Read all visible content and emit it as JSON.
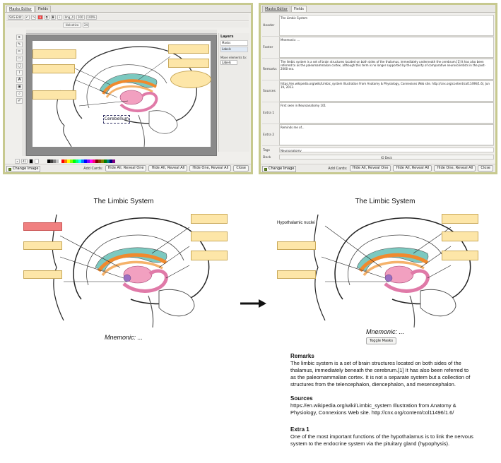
{
  "editor": {
    "tabs": [
      "Masks Editor",
      "Fields"
    ],
    "toolbar": [
      "SVG-Edit",
      "Helvetica",
      "24",
      "Img_4",
      "100",
      "100%"
    ],
    "tools": [
      "arrow-icon",
      "node-icon",
      "pencil-icon",
      "rect-icon",
      "ellipse-icon",
      "path-icon",
      "text-icon",
      "image-icon",
      "zoom-icon",
      "eyedropper-icon"
    ],
    "layers_title": "Layers",
    "layers": [
      "Masks",
      "Labels"
    ],
    "move_label": "Move elements to:",
    "move_value": "Labels",
    "zoom": "41",
    "canvas_label": "Cerebellum",
    "palette": [
      "#000000",
      "#3f3f3f",
      "#7f7f7f",
      "#bfbfbf",
      "#ffffff",
      "#ff0000",
      "#ff7f00",
      "#ffff00",
      "#7fff00",
      "#00ff00",
      "#00ff7f",
      "#00ffff",
      "#007fff",
      "#0000ff",
      "#7f00ff",
      "#ff00ff",
      "#ff007f",
      "#7f0000",
      "#7f3f00",
      "#7f7f00",
      "#007f00",
      "#007f7f",
      "#00007f",
      "#7f007f"
    ]
  },
  "footer": {
    "change_image": "Change Image",
    "add_cards": "Add Cards:",
    "buttons": [
      "Hide All, Reveal One",
      "Hide All, Reveal All",
      "Hide One, Reveal All",
      "Close"
    ]
  },
  "fields": {
    "tabs": [
      "Masks Editor",
      "Fields"
    ],
    "rows": [
      {
        "label": "Header",
        "value": "The Limbic System"
      },
      {
        "label": "Footer",
        "value": "Mnemonic: ..."
      },
      {
        "label": "Remarks",
        "value": "The limbic system is a set of brain structures located on both sides of the thalamus, immediately underneath the cerebrum.[1] It has also been referred to as the paleomammalian cortex, although this term is no longer supported by the majority of comparative neuroscientists in the post-2000 era."
      },
      {
        "label": "Sources",
        "value": "https://en.wikipedia.org/wiki/Limbic_system Illustration From Anatomy & Physiology, Connexions Web site. http://cnx.org/content/col11496/1.6/, Jun 19, 2013."
      },
      {
        "label": "Extra 1",
        "value": "First seen in Neuroanatomy 101"
      },
      {
        "label": "Extra 2",
        "value": "Reminds me of..."
      }
    ],
    "tags_label": "Tags",
    "tags_value": "Neuroanatomy",
    "deck_label": "Deck",
    "deck_value": "IO Deck"
  },
  "card_front": {
    "title": "The Limbic System",
    "mnemonic": "Mnemonic: ..."
  },
  "card_back": {
    "title": "The Limbic System",
    "hypothalamic": "Hypothalamic nuclei",
    "mnemonic": "Mnemonic: ...",
    "toggle": "Toggle Masks",
    "remarks_title": "Remarks",
    "remarks": "The limbic system is a set of brain structures located on both sides of the thalamus, immediately beneath the cerebrum.[1] It has also been referred to as the paleomammalian cortex. It is not a separate system but a collection of structures from the telencephalon, diencephalon, and mesencephalon.",
    "sources_title": "Sources",
    "sources": "https://en.wikipedia.org/wiki/Limbic_system Illustration from Anatomy & Physiology, Connexions Web site. http://cnx.org/content/col11496/1.6/",
    "extra_title": "Extra 1",
    "extra": "One of the most important functions of the hypothalamus is to link the nervous system to the endocrine system via the pituitary gland (hypophysis)."
  }
}
